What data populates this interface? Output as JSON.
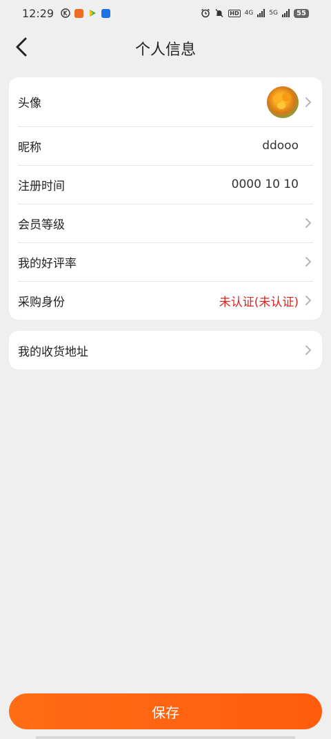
{
  "status_bar": {
    "time": "12:29",
    "network_1": "4G",
    "network_2": "5G",
    "battery": "55",
    "hd_label": "HD"
  },
  "nav": {
    "title": "个人信息"
  },
  "profile": {
    "rows": [
      {
        "label": "头像",
        "value": ""
      },
      {
        "label": "昵称",
        "value": "ddooo"
      },
      {
        "label": "注册时间",
        "value": "0000 10 10"
      },
      {
        "label": "会员等级",
        "value": ""
      },
      {
        "label": "我的好评率",
        "value": ""
      },
      {
        "label": "采购身份",
        "value": "未认证(未认证)"
      }
    ]
  },
  "address": {
    "label": "我的收货地址"
  },
  "save_button": {
    "label": "保存"
  },
  "colors": {
    "accent": "#ff6010",
    "unverified": "#e0201d",
    "background": "#efefef"
  }
}
